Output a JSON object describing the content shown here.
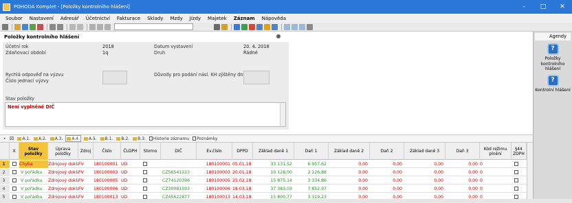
{
  "window": {
    "title": "POHODA Komplet - [Položky kontrolního hlášení]",
    "min": "–",
    "max": "□",
    "close": "✕"
  },
  "menu": [
    "Soubor",
    "Nastavení",
    "Adresář",
    "Účetnictví",
    "Fakturace",
    "Sklady",
    "Mzdy",
    "Jízdy",
    "Majetek",
    "Záznam",
    "Nápověda"
  ],
  "form": {
    "title": "Položky kontrolního hlášení",
    "ucetni_rok_label": "Účetní rok",
    "ucetni_rok": "2018",
    "zdanovaci_label": "Zdaňovací období",
    "zdanovaci": "1q",
    "datum_label": "Datum vystavení",
    "datum": "20. 4. 2018",
    "druh_label": "Druh",
    "druh": "Řádné",
    "rychla_label": "Rychlá odpověď na výzvu",
    "cislo_label": "Číslo jednací výzvy",
    "duvody_label": "Důvody pro podání násl. KH zjištěny dne",
    "stav_label": "Stav položky",
    "stav_value": "Není vyplněné DIČ"
  },
  "tabs": [
    "A.1.",
    "A.2.",
    "A.3.",
    "A.4.",
    "A.5.",
    "B.1.",
    "B.2.",
    "B.3.",
    "Historie záznamu",
    "Poznámky"
  ],
  "columns": {
    "x": "X",
    "stav": "Stav položky",
    "uprava": "Úprava položky",
    "zdroj": "Zdroj",
    "cislo": "Číslo",
    "cldph": "ČLDPH",
    "storno": "Storno",
    "dic": "DIČ",
    "evcislo": "Ev.číslo",
    "dppd": "DPPD",
    "zaklad1": "Základ daně 1",
    "dan1": "Daň 1",
    "zaklad2": "Základ daně 2",
    "dan2": "Daň 2",
    "zaklad3": "Základ daně 3",
    "dan3": "Daň 3",
    "kod": "Kód režimu plnění",
    "s44": "§44 ZDPH"
  },
  "rows": [
    {
      "n": "1",
      "stav": "Chyba",
      "uprava": "Zdrojový doklad",
      "zdroj": "FV",
      "cislo": "180100001",
      "cldph": "UD",
      "dic": "",
      "ev": "180100001",
      "dppd": "05.01.18",
      "z1": "33 131,52",
      "d1": "6 957,62",
      "z2": "0,00",
      "d2": "0,00",
      "z3": "0,00",
      "d3": "0,00",
      "kod": "0"
    },
    {
      "n": "2",
      "stav": "V pořádku",
      "uprava": "Zdrojový doklad",
      "zdroj": "FV",
      "cislo": "180100003",
      "cldph": "UD",
      "dic": "CZ56541223",
      "ev": "180100003",
      "dppd": "20.01.18",
      "z1": "10 128,00",
      "d1": "2 126,88",
      "z2": "0,00",
      "d2": "0,00",
      "z3": "0,00",
      "d3": "0,00",
      "kod": "0"
    },
    {
      "n": "3",
      "stav": "V pořádku",
      "uprava": "Zdrojový doklad",
      "zdroj": "FV",
      "cislo": "180100005",
      "cldph": "UD",
      "dic": "CZ74120396",
      "ev": "180100005",
      "dppd": "25.02.18",
      "z1": "15 875,14",
      "d1": "3 334,86",
      "z2": "0,00",
      "d2": "0,00",
      "z3": "0,00",
      "d3": "0,00",
      "kod": "0"
    },
    {
      "n": "4",
      "stav": "V pořádku",
      "uprava": "Zdrojový doklad",
      "zdroj": "FV",
      "cislo": "180100006",
      "cldph": "UD",
      "dic": "CZ30081593",
      "ev": "180100006",
      "dppd": "18.03.18",
      "z1": "37 383,03",
      "d1": "7 852,97",
      "z2": "0,00",
      "d2": "0,00",
      "z3": "0,00",
      "d3": "0,00",
      "kod": "0"
    },
    {
      "n": "5",
      "stav": "V pořádku",
      "uprava": "Zdrojový doklad",
      "zdroj": "FV",
      "cislo": "180100013",
      "cldph": "UD",
      "dic": "CZ45622877",
      "ev": "180100013",
      "dppd": "14.03.18",
      "z1": "15 800,77",
      "d1": "3 319,23",
      "z2": "0,00",
      "d2": "0,00",
      "z3": "0,00",
      "d3": "0,00",
      "kod": "0"
    }
  ],
  "agenda": {
    "title": "Agendy",
    "item1": "Položky kontrolního hlášení",
    "item2": "Kontrolní hlášení"
  },
  "colors": {
    "titlebar": "#2b78d8",
    "selected": "#f2c33b",
    "error": "#c00000",
    "ok": "#2e8b2e"
  }
}
